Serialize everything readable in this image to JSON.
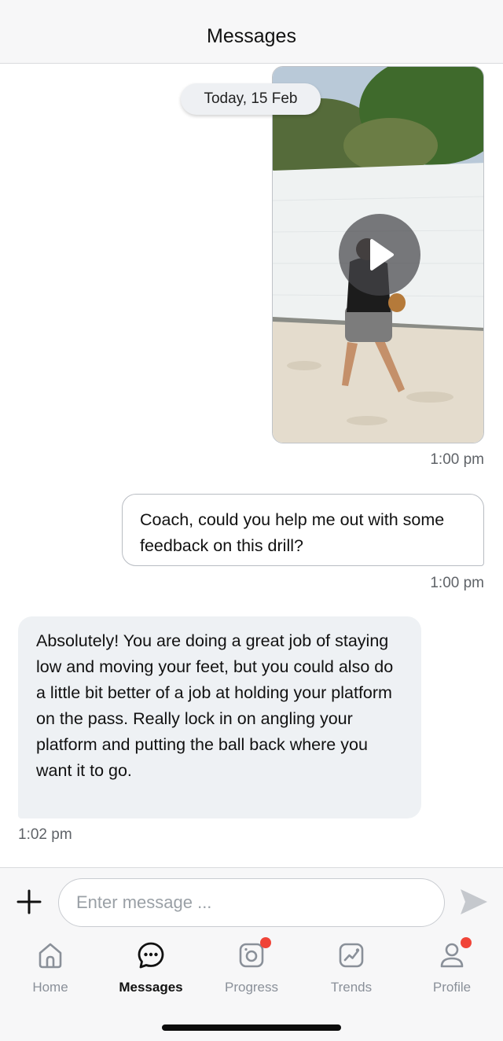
{
  "header": {
    "title": "Messages"
  },
  "thread": {
    "date_divider": "Today, 15 Feb",
    "video_message": {
      "time": "1:00 pm"
    },
    "outgoing_message": {
      "text": "Coach, could you help me out with some feedback on this drill?",
      "time": "1:00 pm"
    },
    "incoming_message": {
      "text": "Absolutely! You are doing a great job of staying low and moving your feet, but you could also do a little bit better of a job at holding your platform on the pass. Really lock in on angling your platform and putting the ball back where you want it to go.",
      "time": "1:02 pm"
    }
  },
  "composer": {
    "placeholder": "Enter message ..."
  },
  "nav": {
    "items": [
      {
        "label": "Home",
        "icon": "home-icon"
      },
      {
        "label": "Messages",
        "icon": "chat-bubble-icon",
        "active": true
      },
      {
        "label": "Progress",
        "icon": "camera-icon",
        "badge": true
      },
      {
        "label": "Trends",
        "icon": "trend-chart-icon"
      },
      {
        "label": "Profile",
        "icon": "person-icon",
        "badge": true
      }
    ]
  },
  "colors": {
    "badge": "#f04438",
    "bubble_incoming": "#eef1f4",
    "active_nav": "#111111",
    "inactive_nav": "#8a9099"
  }
}
